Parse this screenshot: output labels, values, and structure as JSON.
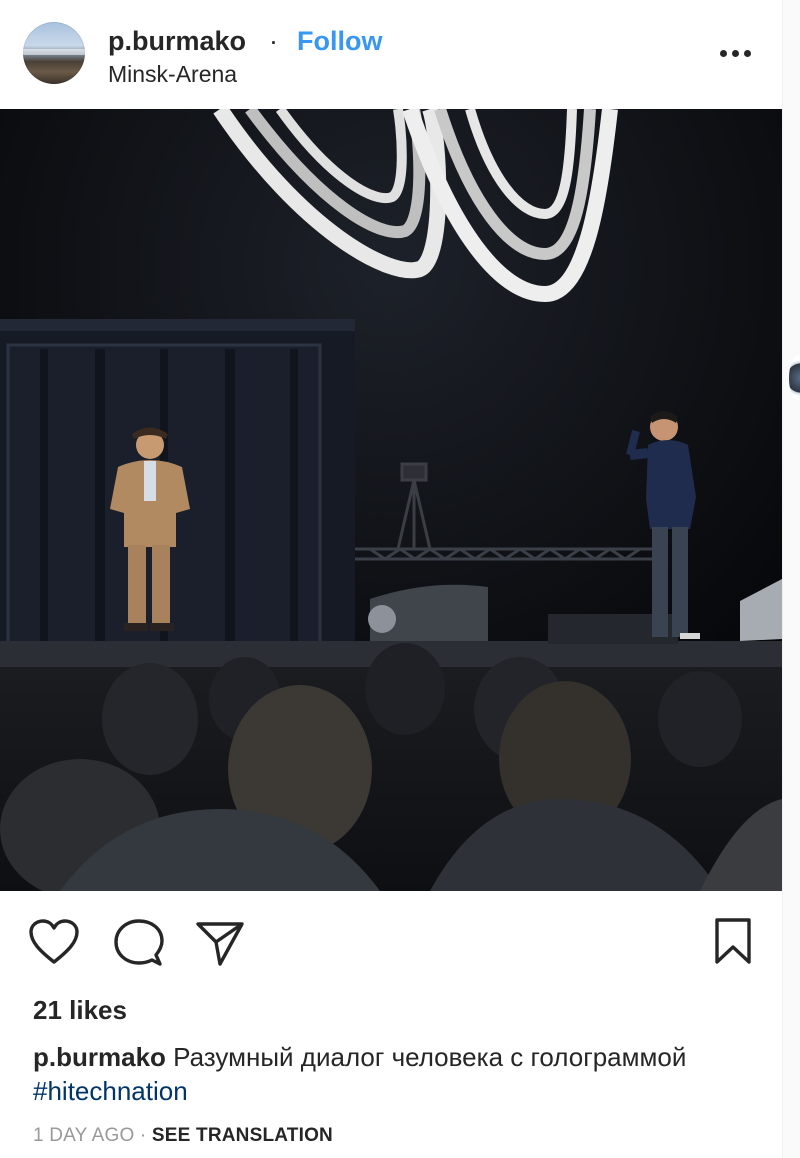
{
  "header": {
    "username": "p.burmako",
    "separator": "·",
    "follow_label": "Follow",
    "location": "Minsk-Arena",
    "more_icon": "more-horizontal-icon"
  },
  "photo": {
    "description_icon": "post-photo"
  },
  "actions": {
    "like_icon": "heart-icon",
    "comment_icon": "comment-icon",
    "share_icon": "paper-plane-icon",
    "save_icon": "bookmark-icon"
  },
  "likes": {
    "text": "21 likes"
  },
  "caption": {
    "username": "p.burmako",
    "text": " Разумный диалог человека с голограммой ",
    "hashtag": "#hitechnation"
  },
  "meta": {
    "time": "1 DAY AGO",
    "separator": " · ",
    "see_translation": "SEE TRANSLATION"
  },
  "colors": {
    "link_blue": "#3897f0",
    "hashtag": "#003569",
    "text": "#262626",
    "muted": "#999999"
  }
}
